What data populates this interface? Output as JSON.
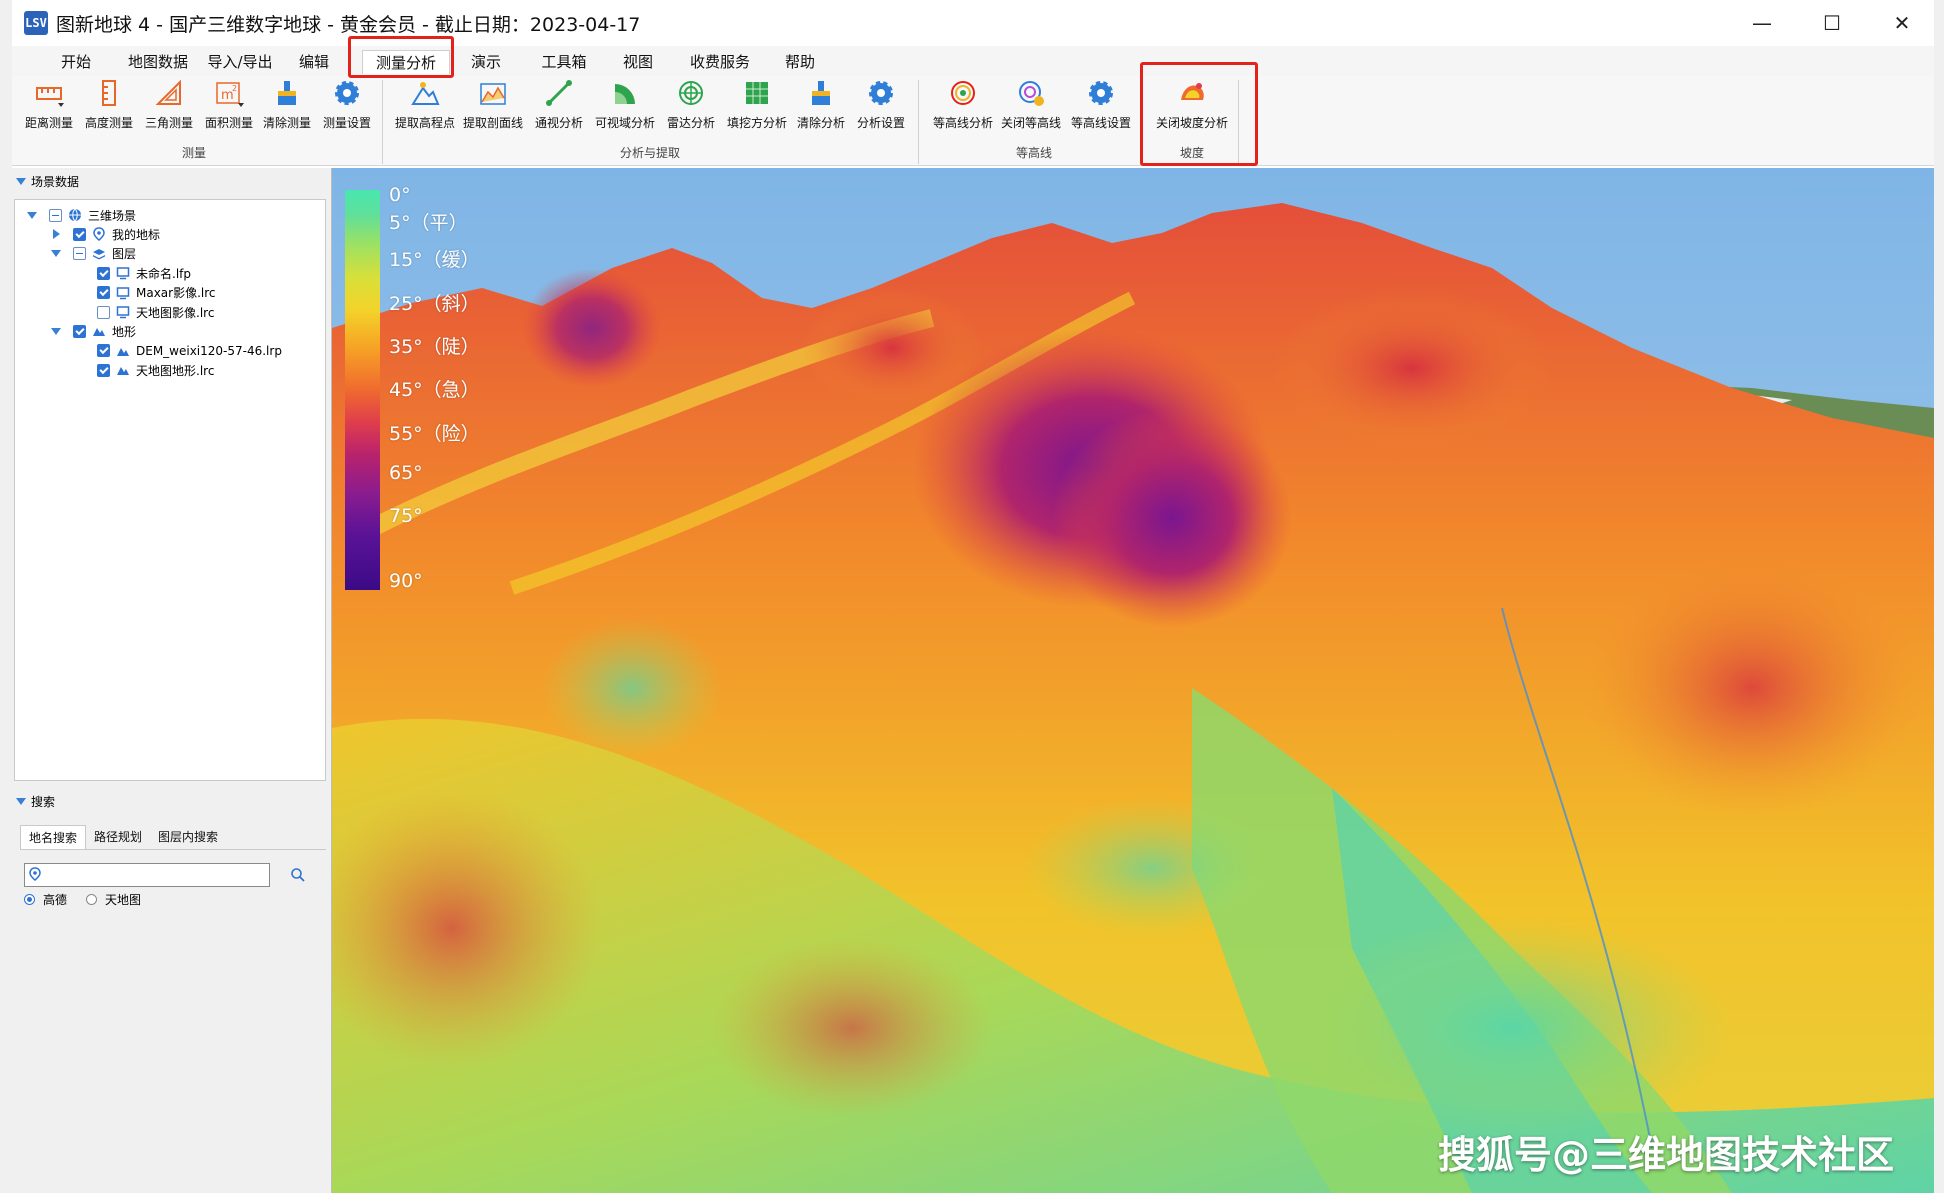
{
  "window": {
    "title": "图新地球 4 - 国产三维数字地球 - 黄金会员 - 截止日期：2023-04-17",
    "logo_text": "LSV",
    "minimize": "—",
    "maximize": "☐",
    "close": "✕"
  },
  "menu": {
    "tabs": [
      "开始",
      "地图数据",
      "导入/导出",
      "编辑",
      "测量分析",
      "演示",
      "工具箱",
      "视图",
      "收费服务",
      "帮助"
    ],
    "active_index": 4
  },
  "ribbon": {
    "measure": {
      "items": [
        "距离测量",
        "高度测量",
        "三角测量",
        "面积测量",
        "清除测量",
        "测量设置"
      ],
      "label": "测量"
    },
    "analysis": {
      "items": [
        "提取高程点",
        "提取剖面线",
        "通视分析",
        "可视域分析",
        "雷达分析",
        "填挖方分析",
        "清除分析",
        "分析设置"
      ],
      "label": "分析与提取"
    },
    "contour": {
      "items": [
        "等高线分析",
        "关闭等高线",
        "等高线设置"
      ],
      "label": "等高线"
    },
    "slope": {
      "items": [
        "关闭坡度分析"
      ],
      "label": "坡度"
    }
  },
  "scene_panel": {
    "header": "场景数据",
    "tree": [
      {
        "label": "三维场景",
        "depth": 0,
        "expander": "down",
        "check": "partial",
        "icon": "globe-icon"
      },
      {
        "label": "我的地标",
        "depth": 1,
        "expander": "right",
        "check": "checked",
        "icon": "placemark-icon"
      },
      {
        "label": "图层",
        "depth": 1,
        "expander": "down",
        "check": "partial",
        "icon": "layers-icon"
      },
      {
        "label": "未命名.lfp",
        "depth": 2,
        "expander": "none",
        "check": "checked",
        "icon": "monitor-icon"
      },
      {
        "label": "Maxar影像.lrc",
        "depth": 2,
        "expander": "none",
        "check": "checked",
        "icon": "monitor-icon"
      },
      {
        "label": "天地图影像.lrc",
        "depth": 2,
        "expander": "none",
        "check": "unchecked",
        "icon": "monitor-icon"
      },
      {
        "label": "地形",
        "depth": 1,
        "expander": "down",
        "check": "checked",
        "icon": "terrain-icon"
      },
      {
        "label": "DEM_weixi120-57-46.lrp",
        "depth": 2,
        "expander": "none",
        "check": "checked",
        "icon": "terrain-icon"
      },
      {
        "label": "天地图地形.lrc",
        "depth": 2,
        "expander": "none",
        "check": "checked",
        "icon": "terrain-icon"
      }
    ]
  },
  "search_panel": {
    "header": "搜索",
    "tabs": [
      "地名搜索",
      "路径规划",
      "图层内搜索"
    ],
    "active_tab": 0,
    "input_value": "",
    "input_placeholder": "",
    "providers": [
      {
        "label": "高德",
        "selected": true
      },
      {
        "label": "天地图",
        "selected": false
      }
    ]
  },
  "legend": {
    "labels": [
      "0°",
      "5°（平）",
      "15°（缓）",
      "25°（斜）",
      "35°（陡）",
      "45°（急）",
      "55°（险）",
      "65°",
      "75°",
      "90°"
    ]
  },
  "watermark": "搜狐号@三维地图技术社区",
  "colors": {
    "highlight": "#e3221c",
    "accent": "#2d73d4"
  }
}
